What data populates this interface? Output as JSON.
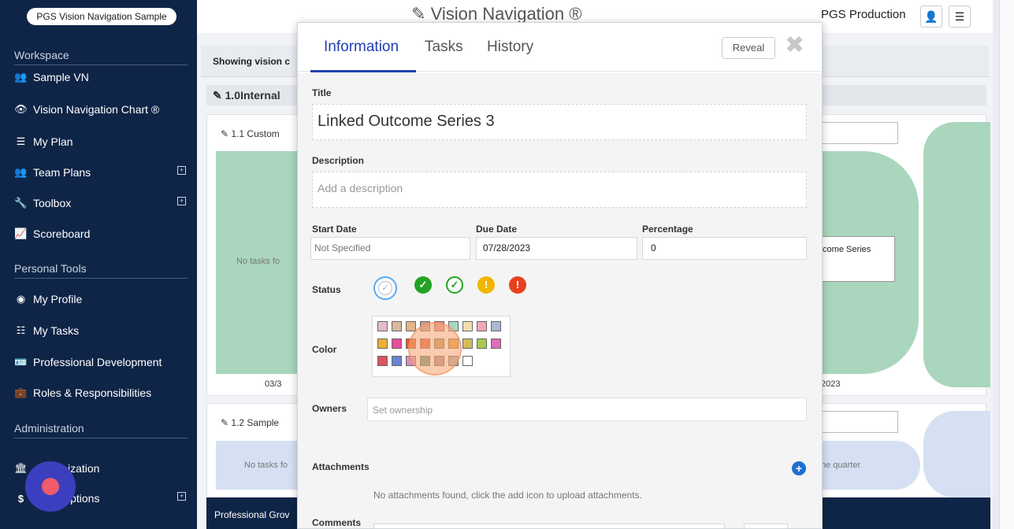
{
  "sidebar": {
    "org_name": "PGS Vision Navigation Sample",
    "sections": {
      "workspace": "Workspace",
      "personal_tools": "Personal Tools",
      "administration": "Administration"
    },
    "items": {
      "sample_vn": "Sample VN",
      "vision_chart": "Vision Navigation Chart ®",
      "my_plan": "My Plan",
      "team_plans": "Team Plans",
      "toolbox": "Toolbox",
      "scoreboard": "Scoreboard",
      "my_profile": "My Profile",
      "my_tasks": "My Tasks",
      "professional_development": "Professional Development",
      "roles_responsibilities": "Roles & Responsibilities",
      "organization": "ization",
      "subscriptions": "iptions"
    }
  },
  "header": {
    "title": "Vision Navigation ®",
    "production_label": "PGS Production"
  },
  "board": {
    "showing_text": "Showing vision c",
    "section_title": "1.0Internal",
    "card1_title": "1.1 Custom",
    "card1_no_tasks": "No tasks fo",
    "card1_date_left": "03/3",
    "card1_outcome": "tcome Series",
    "card1_date_right": "2023",
    "card2_title": "1.2 Sample",
    "card2_no_tasks": "No tasks fo",
    "card2_right": "he quarter",
    "bottom_text": "Professional Grov"
  },
  "modal": {
    "tabs": [
      "Information",
      "Tasks",
      "History"
    ],
    "reveal_label": "Reveal",
    "title_label": "Title",
    "title_value": "Linked Outcome Series 3",
    "description_label": "Description",
    "description_placeholder": "Add a description",
    "start_date_label": "Start Date",
    "start_date_value": "Not Specified",
    "due_date_label": "Due Date",
    "due_date_value": "07/28/2023",
    "percentage_label": "Percentage",
    "percentage_value": "0",
    "status_label": "Status",
    "color_label": "Color",
    "owners_label": "Owners",
    "owners_placeholder": "Set ownership",
    "attachments_label": "Attachments",
    "attachments_empty": "No attachments found, click the add icon to upload attachments.",
    "comments_label": "Comments"
  },
  "colors": {
    "sidebar_bg": "#0f2547",
    "accent": "#1f3fb0",
    "status_green": "#22a322",
    "status_warning": "#f2b600",
    "status_error": "#e8401c",
    "palette_row1": [
      "#e3bcc9",
      "#d9b99a",
      "#e3b48c",
      "#c99a8e",
      "#e68f8f",
      "#a8d9bf",
      "#f5ddb0",
      "#f2a7b8",
      "#a9b9d6"
    ],
    "palette_row2": [
      "#e8b034",
      "#e84d9a",
      "#e65a2e",
      "#e8583a",
      "#b89a5a",
      "#e89b2f",
      "#d2bb5a",
      "#a8c94f",
      "#e06bb8"
    ],
    "palette_row3": [
      "#d95560",
      "#6b82d6",
      "#d68ec2",
      "#5e9e7e",
      "#b08f8f",
      "#a8a8a8",
      "#ffffff"
    ]
  }
}
